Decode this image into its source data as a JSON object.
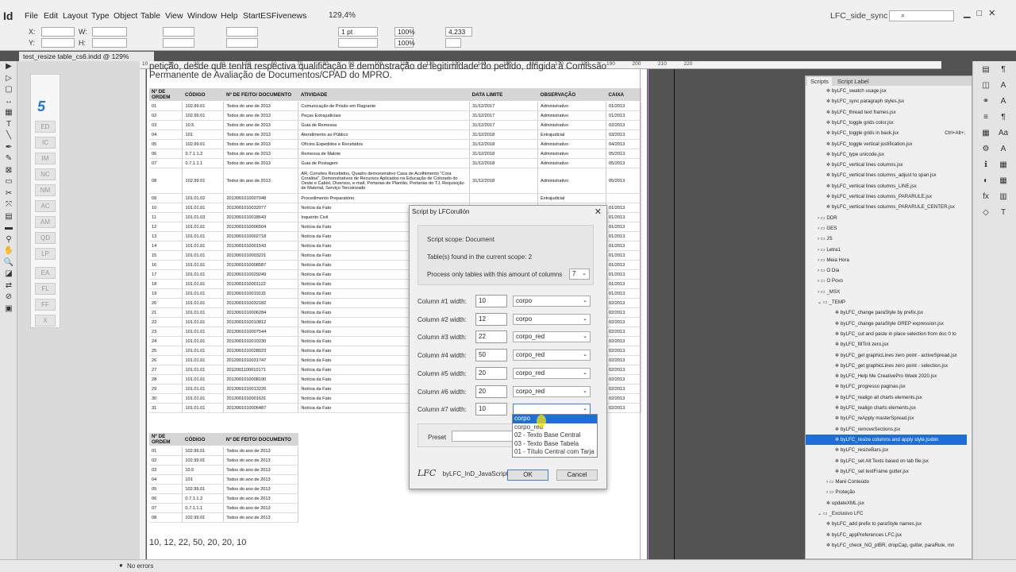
{
  "app": {
    "icon": "Id",
    "zoom": "129,4%",
    "workspace": "LFC_side_sync"
  },
  "menu": [
    "File",
    "Edit",
    "Layout",
    "Type",
    "Object",
    "Table",
    "View",
    "Window",
    "Help",
    "StartES",
    "Fivenews"
  ],
  "control": {
    "x_label": "X:",
    "y_label": "Y:",
    "w_label": "W:",
    "h_label": "H:",
    "stroke": "1 pt",
    "pct1": "100%",
    "pct2": "100%",
    "dim": "4,233 mm"
  },
  "doc_tab": "test_resize table_cs6.indd @ 129%",
  "ruler_ticks": [
    "10",
    "20",
    "30",
    "40",
    "50",
    "60",
    "70",
    "80",
    "90",
    "100",
    "110",
    "120",
    "130",
    "140",
    "150",
    "160",
    "170",
    "180",
    "190",
    "200",
    "210",
    "220"
  ],
  "sidepanel_buttons": [
    "ED",
    "IC",
    "IM",
    "NC",
    "NM",
    "AC",
    "AM",
    "QD",
    "LP",
    "EA",
    "FL",
    "FF",
    "X"
  ],
  "page": {
    "intro": "petição, desde que tenha respectiva qualificação e demonstração de legitimidade do pedido, dirigida à Comissão Permanente de Avaliação de Documentos/CPAD do MPRO.",
    "table1_headers": [
      "Nº DE ORDEM",
      "CÓDIGO",
      "Nº DE FEITO/ DOCUMENTO",
      "ATIVIDADE",
      "DATA LIMITE",
      "OBSERVAÇÃO",
      "CAIXA"
    ],
    "table1_rows": [
      [
        "01",
        "102.99.01",
        "Todos do ano de 2013",
        "Comunicação de Prisão em Flagrante",
        "31/12/2017",
        "Administrativo",
        "01/2013"
      ],
      [
        "02",
        "102.99.01",
        "Todos do ano de 2013",
        "Peças Extrajudiciais",
        "31/12/2017",
        "Administrativo",
        "01/2013"
      ],
      [
        "03",
        "10.5",
        "Todos do ano de 2013",
        "Guia de Remessa",
        "31/12/2017",
        "Administrativo",
        "02/2013"
      ],
      [
        "04",
        "101",
        "Todos do ano de 2013",
        "Atendimento ao Público",
        "31/12/2018",
        "Extrajudicial",
        "03/2013"
      ],
      [
        "05",
        "102.99.01",
        "Todos do ano de 2013",
        "Ofícios Expedidos e Recebidos",
        "31/12/2018",
        "Administrativo",
        "04/2013"
      ],
      [
        "06",
        "0.7.1.1.2",
        "Todos do ano de 2013",
        "Remessa de Malote",
        "31/12/2018",
        "Administrativo",
        "05/2013"
      ],
      [
        "07",
        "0.7.1.1.1",
        "Todos do ano de 2013",
        "Guia de Postagem",
        "31/12/2018",
        "Administrativo",
        "05/2013"
      ],
      [
        "08",
        "102.99.01",
        "Todos do ano de 2013",
        "AR, Convites Recebidos, Quadro demonstrativo Casa de Acolhimento \"Cora Coralina\", Demonstrativos de Recursos Aplicados na Educação de Colorado do Oeste e Cabixi, Diversos, e-mail, Portarias de Plantão, Portarias do TJ, Requisição de Material, Serviço Terceirizado",
        "31/12/2018",
        "Administrativo",
        "05/2013"
      ],
      [
        "09",
        "101.01.02",
        "2013001010007048",
        "Procedimento Preparatório",
        "",
        "Extrajudicial",
        ""
      ],
      [
        "10",
        "101.01.01",
        "2013001010032077",
        "Notícia da Fato",
        "",
        "",
        "01/2013"
      ],
      [
        "11",
        "101.01.03",
        "2013001010018643",
        "Inquérito Civil",
        "",
        "",
        "01/2013"
      ],
      [
        "12",
        "101.01.01",
        "2013001010006504",
        "Notícia da Fato",
        "",
        "",
        "01/2013"
      ],
      [
        "13",
        "101.01.01",
        "2013001010002718",
        "Notícia da Fato",
        "",
        "",
        "01/2013"
      ],
      [
        "14",
        "101.01.01",
        "2013001010001543",
        "Notícia da Fato",
        "",
        "",
        "01/2013"
      ],
      [
        "15",
        "101.01.01",
        "2013001010003221",
        "Notícia da Fato",
        "",
        "",
        "01/2013"
      ],
      [
        "16",
        "101.01.01",
        "2013001010008587",
        "Notícia da Fato",
        "",
        "",
        "01/2013"
      ],
      [
        "17",
        "101.01.01",
        "2013001010029249",
        "Notícia da Fato",
        "",
        "",
        "01/2013"
      ],
      [
        "18",
        "101.01.01",
        "2013001010001122",
        "Notícia da Fato",
        "",
        "",
        "01/2013"
      ],
      [
        "19",
        "101.01.01",
        "2013001010019115",
        "Notícia da Fato",
        "",
        "",
        "01/2013"
      ],
      [
        "20",
        "101.01.01",
        "2013001010032182",
        "Notícia da Fato",
        "",
        "",
        "02/2013"
      ],
      [
        "21",
        "101.01.01",
        "2013001010006284",
        "Notícia da Fato",
        "",
        "",
        "02/2013"
      ],
      [
        "22",
        "101.01.01",
        "2013001010010812",
        "Notícia da Fato",
        "",
        "",
        "02/2013"
      ],
      [
        "23",
        "101.01.01",
        "2013001010007544",
        "Notícia da Fato",
        "",
        "",
        "02/2013"
      ],
      [
        "24",
        "101.01.01",
        "2013001010010230",
        "Notícia da Fato",
        "",
        "",
        "02/2013"
      ],
      [
        "25",
        "101.01.01",
        "2013001010028023",
        "Notícia da Fato",
        "",
        "",
        "02/2013"
      ],
      [
        "26",
        "101.01.01",
        "2012001010031747",
        "Notícia da Fato",
        "",
        "",
        "02/2013"
      ],
      [
        "27",
        "101.01.01",
        "2012001100010171",
        "Notícia da Fato",
        "",
        "",
        "02/2013"
      ],
      [
        "28",
        "101.01.01",
        "2013001010008190",
        "Notícia da Fato",
        "",
        "",
        "02/2013"
      ],
      [
        "29",
        "101.01.01",
        "2013001010013226",
        "Notícia da Fato",
        "",
        "",
        "02/2013"
      ],
      [
        "30",
        "101.01.01",
        "2013001010001631",
        "Notícia da Fato",
        "",
        "",
        "02/2013"
      ],
      [
        "31",
        "101.01.01",
        "2013001010006487",
        "Notícia da Fato",
        "",
        "",
        "02/2013"
      ]
    ],
    "table2_headers": [
      "Nº DE ORDEM",
      "CÓDIGO",
      "Nº DE FEITO/ DOCUMENTO"
    ],
    "table2_rows": [
      [
        "01",
        "102.99.01",
        "Todos do ano de 2013"
      ],
      [
        "02",
        "102.99.01",
        "Todos do ano de 2013"
      ],
      [
        "03",
        "10.5",
        "Todos do ano de 2013"
      ],
      [
        "04",
        "101",
        "Todos do ano de 2013"
      ],
      [
        "05",
        "102.99.01",
        "Todos do ano de 2013"
      ],
      [
        "06",
        "0.7.1.1.2",
        "Todos do ano de 2013"
      ],
      [
        "07",
        "0.7.1.1.1",
        "Todos do ano de 2013"
      ],
      [
        "08",
        "102.99.01",
        "Todos do ano de 2013"
      ]
    ],
    "bottom_text": "10, 12, 22, 50, 20, 20, 10"
  },
  "dialog": {
    "title": "Script by LFCorullón",
    "scope": "Script scope: Document",
    "tables_found": "Table(s) found in the current scope: 2",
    "process_label": "Process only tables with this amount of columns",
    "process_value": "7",
    "columns": [
      {
        "label": "Column #1 width:",
        "width": "10",
        "style": "corpo"
      },
      {
        "label": "Column #2 width:",
        "width": "12",
        "style": "corpo"
      },
      {
        "label": "Column #3 width:",
        "width": "22",
        "style": "corpo_red"
      },
      {
        "label": "Column #4 width:",
        "width": "50",
        "style": "corpo_red"
      },
      {
        "label": "Column #5 width:",
        "width": "20",
        "style": "corpo_red"
      },
      {
        "label": "Column #6 width:",
        "width": "20",
        "style": "corpo_red"
      },
      {
        "label": "Column #7 width:",
        "width": "10",
        "style": ""
      }
    ],
    "dropdown_options": [
      "corpo",
      "corpo_red",
      "02 - Texto Base Central",
      "03 - Texto Base Tabela",
      "01 - Título Central com Tarja"
    ],
    "preset_label": "Preset",
    "footer_sig": "LFC",
    "footer_label": "byLFC_InD_JavaScripts",
    "ok": "OK",
    "cancel": "Cancel"
  },
  "scripts_panel": {
    "tabs": [
      "Scripts",
      "Script Label"
    ],
    "items": [
      {
        "t": "byLFC_swatch usage.jsx",
        "lv": 2
      },
      {
        "t": "byLFC_sync paragraph styles.jsx",
        "lv": 2
      },
      {
        "t": "byLFC_thread text frames.jsx",
        "lv": 2
      },
      {
        "t": "byLFC_toggle grids color.jsx",
        "lv": 2
      },
      {
        "t": "byLFC_toggle grids in back.jsx",
        "lv": 2,
        "short": "Ctrl+Alt+;"
      },
      {
        "t": "byLFC_toggle vertical justification.jsx",
        "lv": 2
      },
      {
        "t": "byLFC_type unicode.jsx",
        "lv": 2
      },
      {
        "t": "byLFC_vertical lines columns.jsx",
        "lv": 2
      },
      {
        "t": "byLFC_vertical lines columns_adjust to span.jsx",
        "lv": 2
      },
      {
        "t": "byLFC_vertical lines columns_LINE.jsx",
        "lv": 2
      },
      {
        "t": "byLFC_vertical lines columns_PARARULE.jsx",
        "lv": 2
      },
      {
        "t": "byLFC_vertical lines columns_PARARULE_CENTER.jsx",
        "lv": 2
      },
      {
        "t": "DDR",
        "lv": 1,
        "folder": true
      },
      {
        "t": "GES",
        "lv": 1,
        "folder": true
      },
      {
        "t": "JS",
        "lv": 1,
        "folder": true
      },
      {
        "t": "Letra1",
        "lv": 1,
        "folder": true
      },
      {
        "t": "Meia Hora",
        "lv": 1,
        "folder": true
      },
      {
        "t": "O Dia",
        "lv": 1,
        "folder": true
      },
      {
        "t": "O Povo",
        "lv": 1,
        "folder": true
      },
      {
        "t": "_MSX",
        "lv": 1,
        "folder": true
      },
      {
        "t": "_TEMP",
        "lv": 1,
        "folder": true,
        "open": true
      },
      {
        "t": "byLFC_change paraStyle by prefix.jsx",
        "lv": 3
      },
      {
        "t": "byLFC_change paraStyle GREP expression.jsx",
        "lv": 3
      },
      {
        "t": "byLFC_cut and paste in place selection from doc 0 to",
        "lv": 3
      },
      {
        "t": "byLFC_fillTint zero.jsx",
        "lv": 3
      },
      {
        "t": "byLFC_get graphicLines zero point - activeSpread.jsx",
        "lv": 3
      },
      {
        "t": "byLFC_get graphicLines zero point - selection.jsx",
        "lv": 3
      },
      {
        "t": "byLFC_Help Me CreativePro Week 2020.jsx",
        "lv": 3
      },
      {
        "t": "byLFC_progresso paginas.jsx",
        "lv": 3
      },
      {
        "t": "byLFC_realign all charts elements.jsx",
        "lv": 3
      },
      {
        "t": "byLFC_realign charts elements.jsx",
        "lv": 3
      },
      {
        "t": "byLFC_reApply masterSpread.jsx",
        "lv": 3
      },
      {
        "t": "byLFC_removeSections.jsx",
        "lv": 3
      },
      {
        "t": "byLFC_resize columns and apply style.jsxbin",
        "lv": 3,
        "selected": true
      },
      {
        "t": "byLFC_resizeBars.jsx",
        "lv": 3
      },
      {
        "t": "byLFC_set Alt Texts based on tab file.jsx",
        "lv": 3
      },
      {
        "t": "byLFC_set textFrame gutter.jsx",
        "lv": 3
      },
      {
        "t": "Maré Conteúdo",
        "lv": 2,
        "folder": true
      },
      {
        "t": "Proteção",
        "lv": 2,
        "folder": true
      },
      {
        "t": "updateXML.jsx",
        "lv": 2
      },
      {
        "t": "_Exclusivo LFC",
        "lv": 1,
        "folder": true,
        "open": true
      },
      {
        "t": "byLFC_add prefix to paraStyle names.jsx",
        "lv": 2
      },
      {
        "t": "byLFC_appPreferences LFC.jsx",
        "lv": 2
      },
      {
        "t": "byLFC_check_NO_ptBR, dropCap, gutter, paraRule, mn",
        "lv": 2
      }
    ]
  },
  "status": {
    "errors": "No errors"
  },
  "colors": {
    "selection": "#1e6ed8",
    "accent": "#2478c8"
  }
}
